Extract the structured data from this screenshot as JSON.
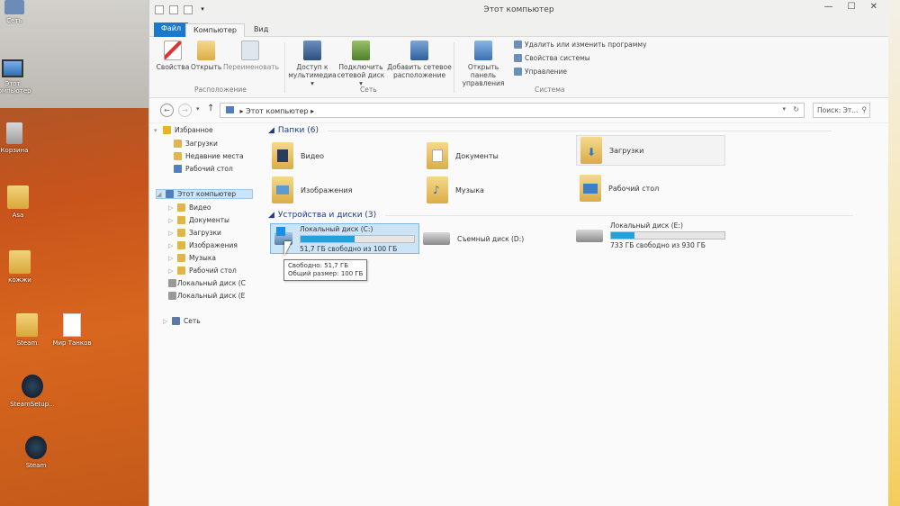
{
  "desktop": {
    "icons": [
      {
        "label": "Сеть",
        "kind": "network"
      },
      {
        "label": "Этот компьютер",
        "kind": "pc"
      },
      {
        "label": "Корзина",
        "kind": "trash"
      },
      {
        "label": "Asa",
        "kind": "folder"
      },
      {
        "label": "кожжи",
        "kind": "folder"
      },
      {
        "label": "Steam",
        "kind": "folder"
      },
      {
        "label": "Мир Танков",
        "kind": "file"
      },
      {
        "label": "SteamSetup...",
        "kind": "steam"
      },
      {
        "label": "Steam",
        "kind": "steam"
      }
    ]
  },
  "window": {
    "title": "Этот компьютер",
    "tabs": [
      "Файл",
      "Компьютер",
      "Вид"
    ],
    "ribbon": {
      "buttons": [
        {
          "label": "Свойства"
        },
        {
          "label": "Открыть"
        },
        {
          "label": "Переименовать"
        },
        {
          "label": "Доступ к мультимедиа ▾"
        },
        {
          "label": "Подключить сетевой диск ▾"
        },
        {
          "label": "Добавить сетевое расположение"
        },
        {
          "label": "Открыть панель управления"
        }
      ],
      "small_items": [
        "Удалить или изменить программу",
        "Свойства системы",
        "Управление"
      ],
      "groups": [
        "Расположение",
        "Сеть",
        "Система"
      ]
    },
    "address": {
      "path": "Этот компьютер",
      "search_placeholder": "Поиск: Эт..."
    },
    "nav": [
      {
        "label": "Избранное",
        "level": 0,
        "icon": "star-icon"
      },
      {
        "label": "Загрузки",
        "level": 1,
        "icon": "folder-icon"
      },
      {
        "label": "Недавние места",
        "level": 1,
        "icon": "folder-icon"
      },
      {
        "label": "Рабочий стол",
        "level": 1,
        "icon": "desktop-icon"
      },
      {
        "label": "Этот компьютер",
        "level": 0,
        "icon": "pc-icon"
      },
      {
        "label": "Видео",
        "level": 1,
        "icon": "folder-icon"
      },
      {
        "label": "Документы",
        "level": 1,
        "icon": "folder-icon"
      },
      {
        "label": "Загрузки",
        "level": 1,
        "icon": "folder-icon"
      },
      {
        "label": "Изображения",
        "level": 1,
        "icon": "folder-icon"
      },
      {
        "label": "Музыка",
        "level": 1,
        "icon": "folder-icon"
      },
      {
        "label": "Рабочий стол",
        "level": 1,
        "icon": "folder-icon"
      },
      {
        "label": "Локальный диск (C",
        "level": 1,
        "icon": "drive-icon"
      },
      {
        "label": "Локальный диск (E",
        "level": 1,
        "icon": "drive-icon"
      },
      {
        "label": "Сеть",
        "level": 0,
        "icon": "network-icon"
      }
    ],
    "folders_header": "Папки (6)",
    "folders": [
      "Видео",
      "Документы",
      "Загрузки",
      "Изображения",
      "Музыка",
      "Рабочий стол"
    ],
    "devices_header": "Устройства и диски (3)",
    "drives": [
      {
        "name": "Локальный диск (C:)",
        "free_text": "51,7 ГБ свободно из 100 ГБ",
        "used_fraction": 0.48
      },
      {
        "name": "Съемный диск (D:)",
        "free_text": "",
        "used_fraction": null
      },
      {
        "name": "Локальный диск (E:)",
        "free_text": "733 ГБ свободно из 930 ГБ",
        "used_fraction": 0.21
      }
    ],
    "tooltip": {
      "line1": "Свободно: 51,7 ГБ",
      "line2": "Общий размер: 100 ГБ"
    }
  }
}
